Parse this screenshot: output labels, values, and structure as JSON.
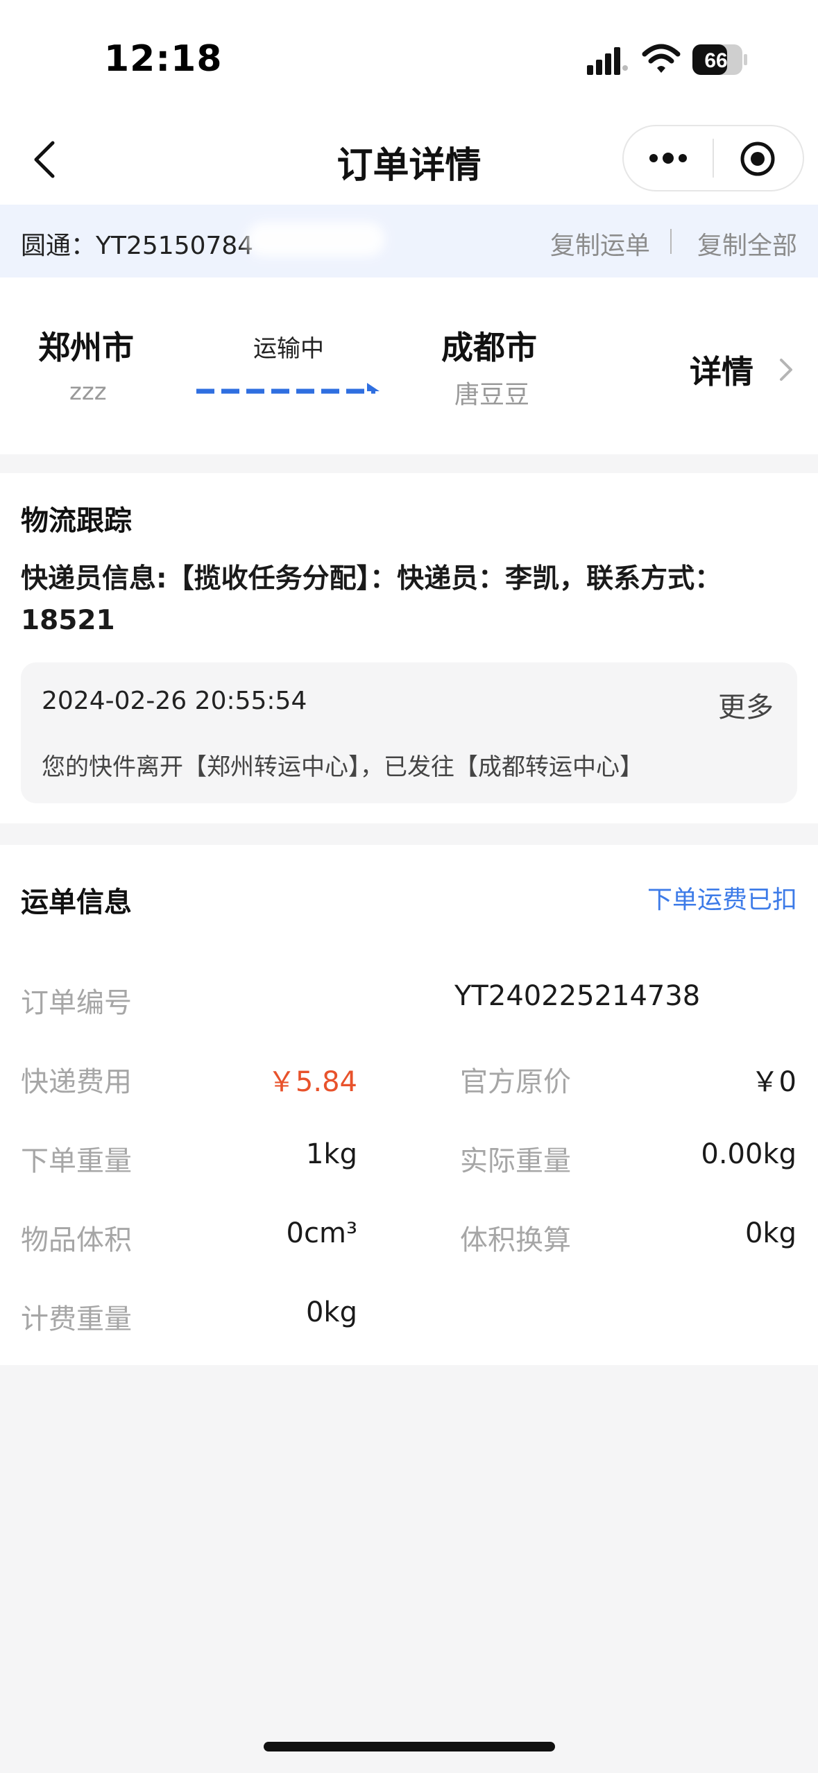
{
  "status_bar": {
    "time": "12:18",
    "battery": "66"
  },
  "nav": {
    "title": "订单详情"
  },
  "tracking": {
    "carrier_prefix": "圆通：YT25150784",
    "copy_bill": "复制运单",
    "copy_all": "复制全部"
  },
  "route": {
    "from_city": "郑州市",
    "from_name": "zzz",
    "status": "运输中",
    "to_city": "成都市",
    "to_name": "唐豆豆",
    "detail_label": "详情"
  },
  "logistics": {
    "title": "物流跟踪",
    "courier_line1": "快递员信息:【揽收任务分配】：快递员：李凯，联系方式：",
    "courier_line2": "18521",
    "event_time": "2024-02-26 20:55:54",
    "event_more": "更多",
    "event_desc": "您的快件离开【郑州转运中心】，已发往【成都转运中心】"
  },
  "waybill": {
    "title": "运单信息",
    "status": "下单运费已扣",
    "order_no_label": "订单编号",
    "order_no_value": "YT240225214738",
    "fee_label": "快递费用",
    "fee_value": "￥5.84",
    "original_price_label": "官方原价",
    "original_price_value": "￥0",
    "order_weight_label": "下单重量",
    "order_weight_value": "1kg",
    "actual_weight_label": "实际重量",
    "actual_weight_value": "0.00kg",
    "volume_label": "物品体积",
    "volume_value": "0cm³",
    "volume_conv_label": "体积换算",
    "volume_conv_value": "0kg",
    "billing_weight_label": "计费重量",
    "billing_weight_value": "0kg"
  },
  "colors": {
    "accent_blue": "#3d7be8",
    "price_red": "#e8522b",
    "track_bar_bg": "#eef3fd"
  }
}
